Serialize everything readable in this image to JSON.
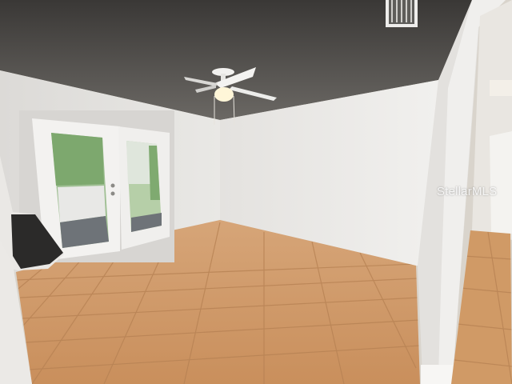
{
  "watermark": {
    "text": "StellarMLS"
  },
  "colors": {
    "ceiling": "#3e3c3a",
    "wall_left": "#e6e4e1",
    "wall_back": "#ecebe8",
    "floor": "#cf9966",
    "floor_grout": "#b98455",
    "door_frame": "#f4f3f1",
    "glass_outdoor": "#9cc18f"
  },
  "scene": {
    "items": [
      "textured-ceiling",
      "ceiling-fan",
      "air-vent",
      "french-doors",
      "tile-floor",
      "hallway-opening",
      "counter-edge"
    ]
  }
}
